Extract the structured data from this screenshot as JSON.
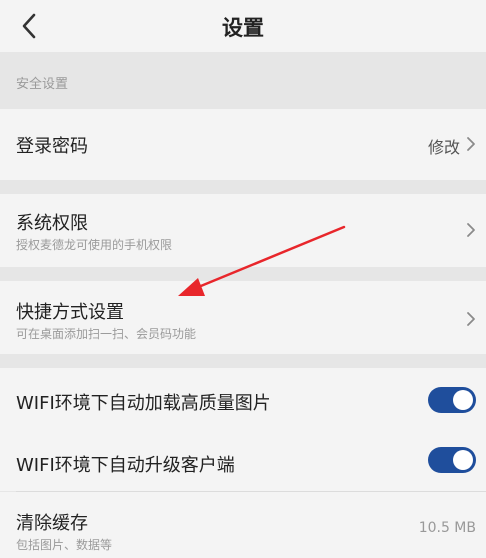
{
  "header": {
    "title": "设置"
  },
  "security_section": {
    "label": "安全设置"
  },
  "login_password": {
    "label": "登录密码",
    "action": "修改"
  },
  "system_permissions": {
    "label": "系统权限",
    "sub": "授权麦德龙可使用的手机权限"
  },
  "shortcut_settings": {
    "label": "快捷方式设置",
    "sub": "可在桌面添加扫一扫、会员码功能"
  },
  "wifi_images": {
    "label": "WIFI环境下自动加载高质量图片",
    "enabled": true
  },
  "wifi_upgrade": {
    "label": "WIFI环境下自动升级客户端",
    "enabled": true
  },
  "clear_cache": {
    "label": "清除缓存",
    "sub": "包括图片、数据等",
    "size": "10.5 MB"
  },
  "colors": {
    "accent": "#1f4e9c",
    "annotation_arrow": "#e8262b",
    "background": "#e6e6e6",
    "card": "#f4f4f4"
  }
}
